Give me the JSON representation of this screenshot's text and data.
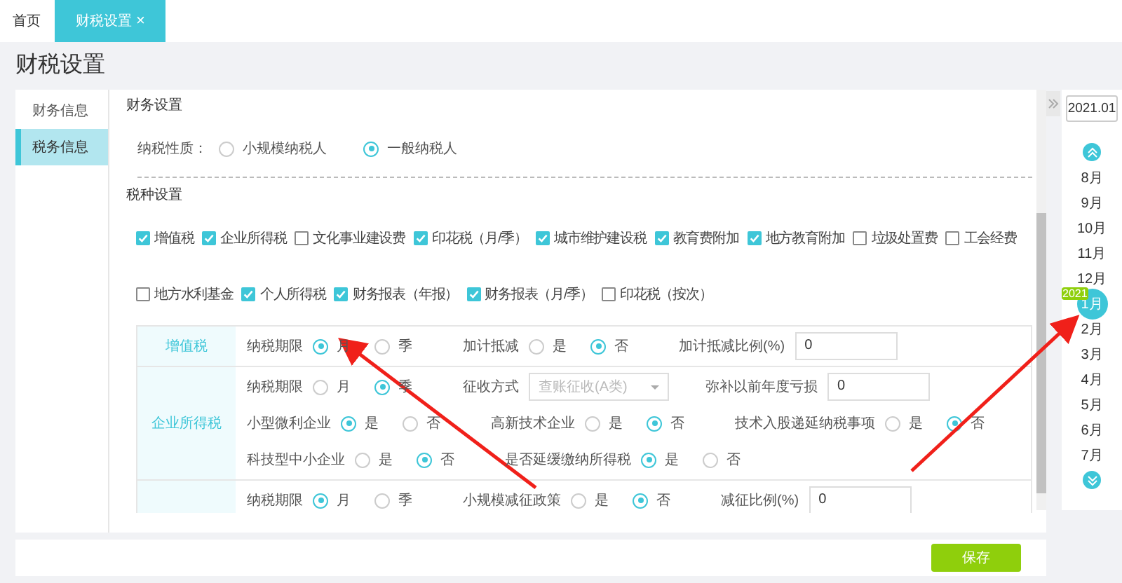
{
  "tabs": [
    {
      "label": "首页",
      "selected": false,
      "closable": false
    },
    {
      "label": "财税设置",
      "selected": true,
      "closable": true
    }
  ],
  "close_glyph": "×",
  "page_title": "财税设置",
  "sidebar": {
    "items": [
      {
        "label": "财务信息",
        "selected": false
      },
      {
        "label": "税务信息",
        "selected": true
      }
    ]
  },
  "finance_section": {
    "title": "财务设置",
    "field": {
      "label": "纳税性质：",
      "options": [
        {
          "label": "小规模纳税人",
          "selected": false
        },
        {
          "label": "一般纳税人",
          "selected": true
        }
      ]
    }
  },
  "tax_section": {
    "title": "税种设置",
    "checkbox_rows": [
      [
        {
          "label": "增值税",
          "checked": true
        },
        {
          "label": "企业所得税",
          "checked": true
        },
        {
          "label": "文化事业建设费",
          "checked": false
        },
        {
          "label": "印花税（月/季）",
          "checked": true
        },
        {
          "label": "城市维护建设税",
          "checked": true
        },
        {
          "label": "教育费附加",
          "checked": true
        },
        {
          "label": "地方教育附加",
          "checked": true
        },
        {
          "label": "垃圾处置费",
          "checked": false
        },
        {
          "label": "工会经费",
          "checked": false
        }
      ],
      [
        {
          "label": "地方水利基金",
          "checked": false
        },
        {
          "label": "个人所得税",
          "checked": true
        },
        {
          "label": "财务报表（年报）",
          "checked": true
        },
        {
          "label": "财务报表（月/季）",
          "checked": true
        },
        {
          "label": "印花税（按次）",
          "checked": false
        }
      ]
    ]
  },
  "tax_table": [
    {
      "name": "增值税",
      "lines": [
        [
          {
            "kind": "radio",
            "label": "纳税期限",
            "options": [
              {
                "label": "月",
                "selected": true
              },
              {
                "label": "季",
                "selected": false
              }
            ]
          },
          {
            "kind": "radio",
            "label": "加计抵减",
            "options": [
              {
                "label": "是",
                "selected": false
              },
              {
                "label": "否",
                "selected": true
              }
            ]
          },
          {
            "kind": "input",
            "label": "加计抵减比例(%)",
            "value": "0"
          }
        ]
      ]
    },
    {
      "name": "企业所得税",
      "lines": [
        [
          {
            "kind": "radio",
            "label": "纳税期限",
            "options": [
              {
                "label": "月",
                "selected": false
              },
              {
                "label": "季",
                "selected": true
              }
            ]
          },
          {
            "kind": "select",
            "label": "征收方式",
            "placeholder": "查账征收(A类)"
          },
          {
            "kind": "input",
            "label": "弥补以前年度亏损",
            "value": "0"
          }
        ],
        [
          {
            "kind": "radio",
            "label": "小型微利企业",
            "options": [
              {
                "label": "是",
                "selected": true
              },
              {
                "label": "否",
                "selected": false
              }
            ]
          },
          {
            "kind": "radio",
            "label": "高新技术企业",
            "options": [
              {
                "label": "是",
                "selected": false
              },
              {
                "label": "否",
                "selected": true
              }
            ]
          },
          {
            "kind": "radio",
            "label": "技术入股递延纳税事项",
            "options": [
              {
                "label": "是",
                "selected": false
              },
              {
                "label": "否",
                "selected": true
              }
            ]
          }
        ],
        [
          {
            "kind": "radio",
            "label": "科技型中小企业",
            "options": [
              {
                "label": "是",
                "selected": false
              },
              {
                "label": "否",
                "selected": true
              }
            ]
          },
          {
            "kind": "radio",
            "label": "是否延缓缴纳所得税",
            "options": [
              {
                "label": "是",
                "selected": true
              },
              {
                "label": "否",
                "selected": false
              }
            ]
          }
        ]
      ]
    },
    {
      "lines": [
        [
          {
            "kind": "radio",
            "label": "纳税期限",
            "options": [
              {
                "label": "月",
                "selected": true
              },
              {
                "label": "季",
                "selected": false
              }
            ]
          },
          {
            "kind": "radio",
            "label": "小规模减征政策",
            "options": [
              {
                "label": "是",
                "selected": false
              },
              {
                "label": "否",
                "selected": true
              }
            ]
          },
          {
            "kind": "input",
            "label": "减征比例(%)",
            "value": "0"
          }
        ]
      ]
    }
  ],
  "save_button": "保存",
  "period_picker": {
    "value": "2021.01",
    "year_badge": "2021",
    "months": [
      {
        "label": "8月",
        "selected": false
      },
      {
        "label": "9月",
        "selected": false
      },
      {
        "label": "10月",
        "selected": false
      },
      {
        "label": "11月",
        "selected": false
      },
      {
        "label": "12月",
        "selected": false
      },
      {
        "label": "1月",
        "selected": true
      },
      {
        "label": "2月",
        "selected": false
      },
      {
        "label": "3月",
        "selected": false
      },
      {
        "label": "4月",
        "selected": false
      },
      {
        "label": "5月",
        "selected": false
      },
      {
        "label": "6月",
        "selected": false
      },
      {
        "label": "7月",
        "selected": false
      }
    ]
  }
}
